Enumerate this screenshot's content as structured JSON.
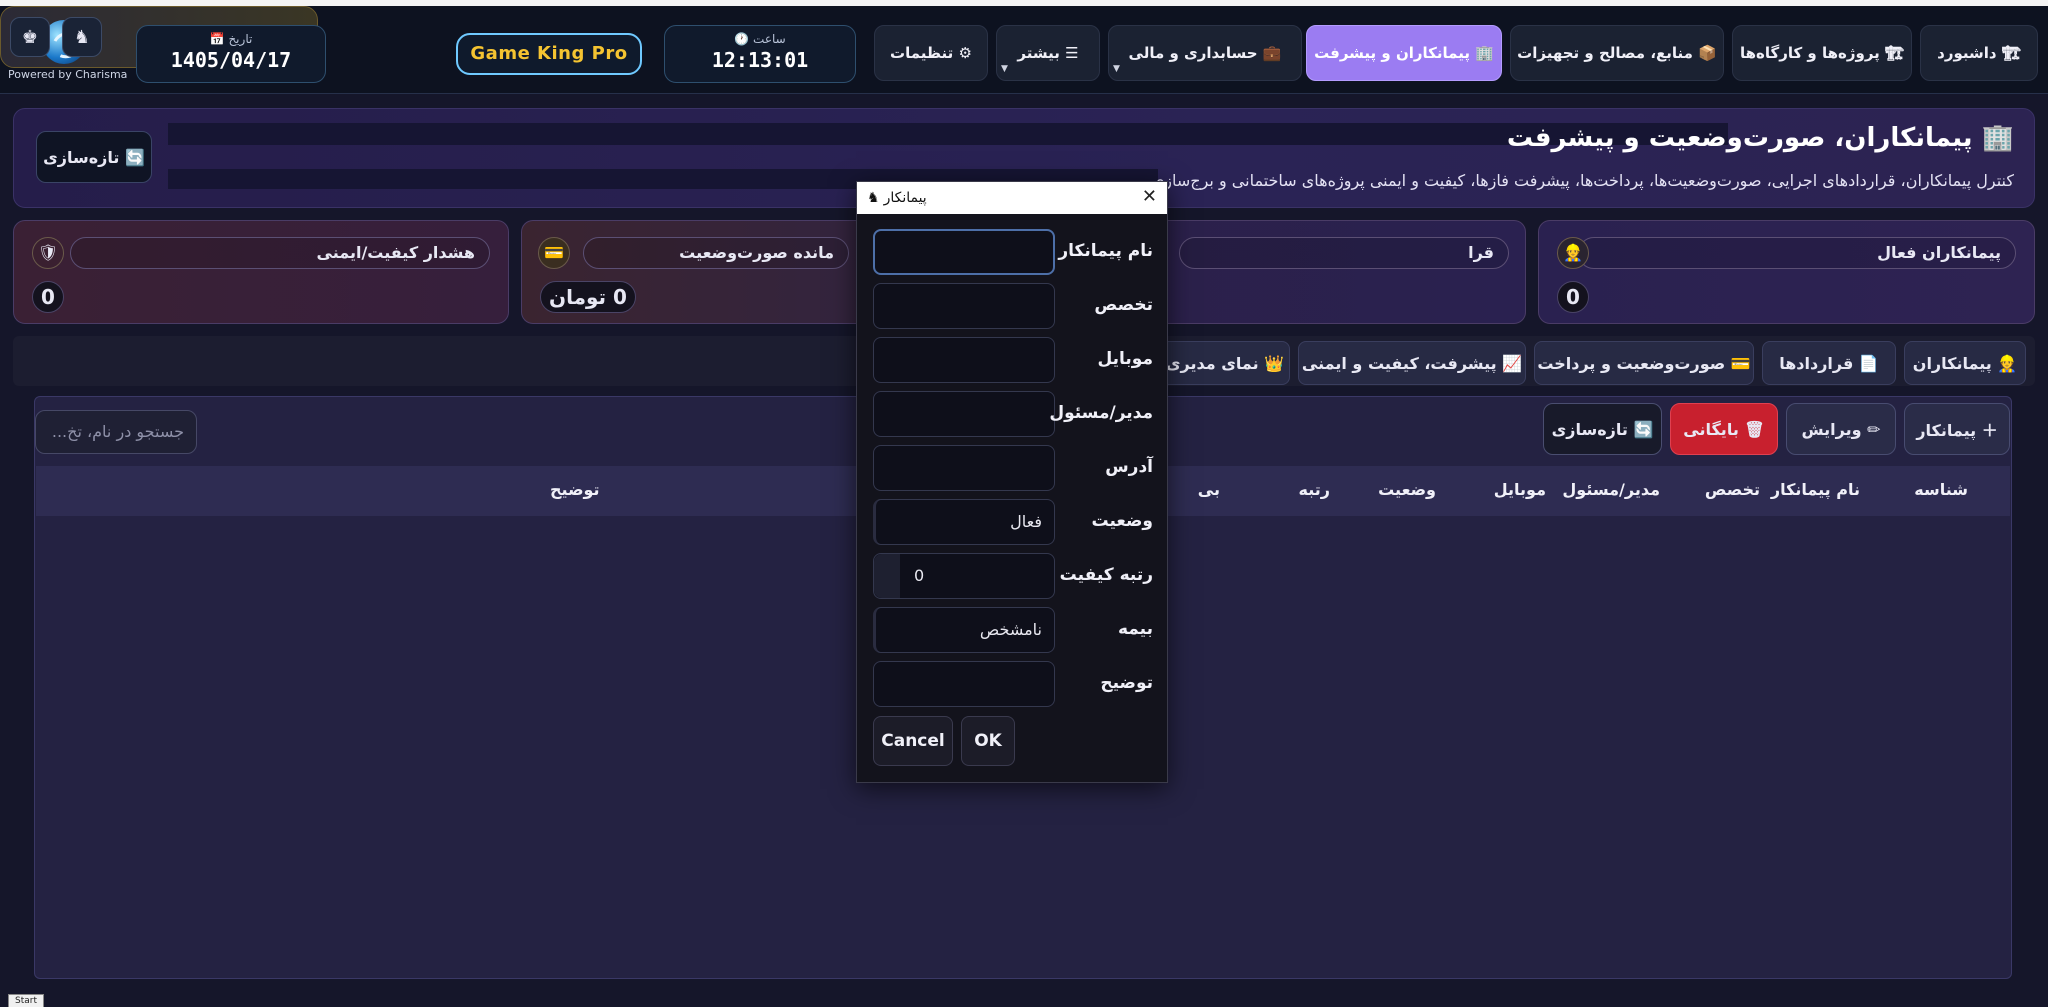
{
  "logo": {
    "text": "Powered by Charisma"
  },
  "date": {
    "label": "📅 تاریخ",
    "value": "1405/04/17"
  },
  "clock": {
    "label": "🕐 ساعت",
    "value": "12:13:01"
  },
  "game": {
    "title": "Game King Pro"
  },
  "nav": {
    "settings": "⚙ تنظیمات",
    "more": "☰ بیشتر",
    "finance": "💼 حسابداری و مالی",
    "contractors": "🏢 پیمانکاران و پیشرفت",
    "resources": "📦 منابع، مصالح و تجهیزات",
    "projects": "🏗 پروژه‌ها و کارگاه‌ها",
    "dashboard": "🏗 داشبورد"
  },
  "header": {
    "title": "🏢 پیمانکاران، صورت‌وضعیت و پیشرفت",
    "subtitle": "کنترل پیمانکاران، قراردادهای اجرایی، صورت‌وضعیت‌ها، پرداخت‌ها، پیشرفت فازها، کیفیت و ایمنی پروژه‌های ساختمانی و برج‌سازی",
    "refresh": "🔄 تازه‌سازی"
  },
  "stats": [
    {
      "label": "پیمانکاران فعال",
      "icon": "👷",
      "value": "0"
    },
    {
      "label": "قرا",
      "icon": "",
      "value": ""
    },
    {
      "label": "مانده صورت‌وضعیت",
      "icon": "💳",
      "value": "0 تومان"
    },
    {
      "label": "هشدار کیفیت/ایمنی",
      "icon": "🛡",
      "value": "0"
    }
  ],
  "tabs": [
    {
      "label": "👷 پیمانکاران"
    },
    {
      "label": "📄 قراردادها"
    },
    {
      "label": "💳 صورت‌وضعیت و پرداخت"
    },
    {
      "label": "📈 پیشرفت، کیفیت و ایمنی"
    },
    {
      "label": "👑 نمای مدیری"
    }
  ],
  "toolbar": {
    "add": "＋ پیمانکار",
    "edit": "✏ ویرایش",
    "archive": "🗑 بایگانی",
    "refresh": "🔄 تازه‌سازی",
    "search_placeholder": "جستجو در نام، تخ..."
  },
  "table": {
    "columns": [
      "شناسه",
      "نام پیمانکار",
      "تخصص",
      "مدیر/مسئول",
      "موبایل",
      "وضعیت",
      "رتبه",
      "بی",
      "توضیح"
    ]
  },
  "dialog": {
    "title": "پیمانکار",
    "icon": "♞",
    "fields": [
      {
        "label": "نام پیمانکار",
        "value": ""
      },
      {
        "label": "تخصص",
        "value": ""
      },
      {
        "label": "موبایل",
        "value": ""
      },
      {
        "label": "مدیر/مسئول",
        "value": ""
      },
      {
        "label": "آدرس",
        "value": ""
      },
      {
        "label": "وضعیت",
        "value": "فعال"
      },
      {
        "label": "رتبه کیفیت",
        "value": "0"
      },
      {
        "label": "بیمه",
        "value": "نامشخص"
      },
      {
        "label": "توضیح",
        "value": ""
      }
    ],
    "cancel": "Cancel",
    "ok": "OK"
  },
  "taskbar": {
    "start": "Start"
  }
}
